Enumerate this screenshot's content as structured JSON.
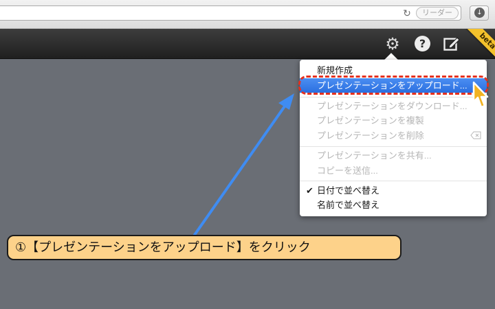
{
  "browser": {
    "reader_label": "リーダー",
    "reload_icon": "reload-icon",
    "download_icon": "download-icon"
  },
  "toolbar": {
    "beta_label": "beta",
    "help_label": "?",
    "icons": [
      "gear-icon",
      "help-icon",
      "compose-icon"
    ]
  },
  "menu": {
    "items": [
      {
        "label": "新規作成",
        "state": "enabled"
      },
      {
        "label": "プレゼンテーションをアップロード...",
        "state": "highlighted"
      },
      {
        "label": "プレゼンテーションをダウンロード...",
        "state": "disabled"
      },
      {
        "label": "プレゼンテーションを複製",
        "state": "disabled"
      },
      {
        "label": "プレゼンテーションを削除",
        "state": "disabled"
      },
      {
        "label": "プレゼンテーションを共有...",
        "state": "disabled"
      },
      {
        "label": "コピーを送信...",
        "state": "disabled"
      },
      {
        "label": "日付で並べ替え",
        "state": "checked"
      },
      {
        "label": "名前で並べ替え",
        "state": "enabled"
      }
    ]
  },
  "annotation": {
    "callout_text": "①【プレゼンテーションをアップロード】をクリック"
  },
  "colors": {
    "highlight": "#2b6fe0",
    "outline": "#e5301f",
    "arrow": "#3f8cf2",
    "callout_bg": "#fdd28a",
    "beta_ribbon": "#f3c12c"
  }
}
